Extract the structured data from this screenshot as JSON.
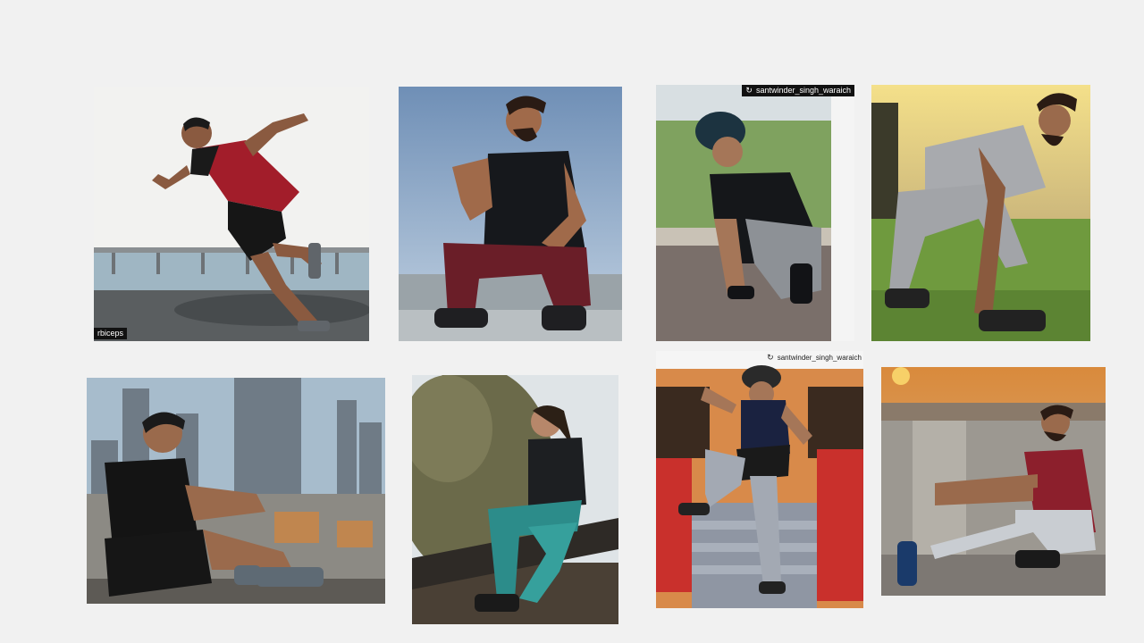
{
  "photos": [
    {
      "subject": "man in red shirt sprinting on seaside rocks",
      "watermark": "rbiceps"
    },
    {
      "subject": "bearded man in black tee squatting on rooftop"
    },
    {
      "subject": "man in turban tying shoelaces",
      "credit": "santwinder_singh_waraich"
    },
    {
      "subject": "bearded man in grey outfit lunging on grass"
    },
    {
      "subject": "young man sitting on ledge above city skyline"
    },
    {
      "subject": "woman in teal track pants sitting on bench"
    },
    {
      "subject": "man in turban doing knee raise on steps",
      "credit": "santwinder_singh_waraich"
    },
    {
      "subject": "bearded man in red shirt doing pistol squat"
    }
  ],
  "colors": {
    "background": "#f1f1f1",
    "tag_background": "#111111"
  }
}
